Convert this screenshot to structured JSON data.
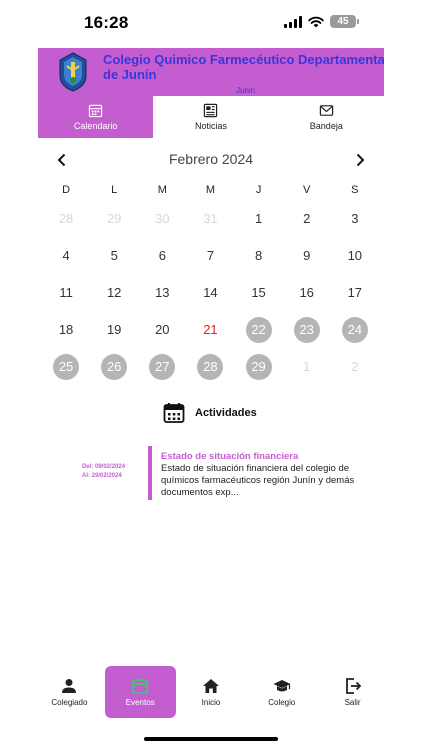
{
  "status": {
    "time": "16:28",
    "battery": "45"
  },
  "header": {
    "title_line1": "Colegio Quimico Farmecéutico Departamental",
    "title_line2": "de Junín",
    "subtitle": "Junin"
  },
  "tabs": [
    {
      "label": "Calendario",
      "icon": "calendar-icon",
      "active": true
    },
    {
      "label": "Noticias",
      "icon": "newspaper-icon",
      "active": false
    },
    {
      "label": "Bandeja",
      "icon": "mail-icon",
      "active": false
    }
  ],
  "calendar": {
    "month": "Febrero 2024",
    "weekdays": [
      "D",
      "L",
      "M",
      "M",
      "J",
      "V",
      "S"
    ],
    "weeks": [
      [
        {
          "d": "28",
          "s": "muted"
        },
        {
          "d": "29",
          "s": "muted"
        },
        {
          "d": "30",
          "s": "muted"
        },
        {
          "d": "31",
          "s": "muted"
        },
        {
          "d": "1",
          "s": ""
        },
        {
          "d": "2",
          "s": ""
        },
        {
          "d": "3",
          "s": ""
        }
      ],
      [
        {
          "d": "4",
          "s": ""
        },
        {
          "d": "5",
          "s": ""
        },
        {
          "d": "6",
          "s": ""
        },
        {
          "d": "7",
          "s": ""
        },
        {
          "d": "8",
          "s": ""
        },
        {
          "d": "9",
          "s": ""
        },
        {
          "d": "10",
          "s": ""
        }
      ],
      [
        {
          "d": "11",
          "s": ""
        },
        {
          "d": "12",
          "s": ""
        },
        {
          "d": "13",
          "s": ""
        },
        {
          "d": "14",
          "s": ""
        },
        {
          "d": "15",
          "s": ""
        },
        {
          "d": "16",
          "s": ""
        },
        {
          "d": "17",
          "s": ""
        }
      ],
      [
        {
          "d": "18",
          "s": ""
        },
        {
          "d": "19",
          "s": ""
        },
        {
          "d": "20",
          "s": ""
        },
        {
          "d": "21",
          "s": "today"
        },
        {
          "d": "22",
          "s": "marked"
        },
        {
          "d": "23",
          "s": "marked"
        },
        {
          "d": "24",
          "s": "marked"
        }
      ],
      [
        {
          "d": "25",
          "s": "marked"
        },
        {
          "d": "26",
          "s": "marked"
        },
        {
          "d": "27",
          "s": "marked"
        },
        {
          "d": "28",
          "s": "marked"
        },
        {
          "d": "29",
          "s": "marked"
        },
        {
          "d": "1",
          "s": "muted"
        },
        {
          "d": "2",
          "s": "muted"
        }
      ]
    ]
  },
  "activities": {
    "title": "Actividades",
    "events": [
      {
        "from": "Del: 09/02/2024",
        "to": "Al: 29/02/2024",
        "title": "Estado de situación financiera",
        "description": "Estado de situación financiera del colegio de químicos farmacéuticos región Junín y demás documentos exp..."
      }
    ]
  },
  "bottom_nav": [
    {
      "label": "Colegiado",
      "icon": "person-icon",
      "active": false
    },
    {
      "label": "Eventos",
      "icon": "calendar-icon",
      "active": true
    },
    {
      "label": "Inicio",
      "icon": "home-icon",
      "active": false
    },
    {
      "label": "Colegio",
      "icon": "graduation-cap-icon",
      "active": false
    },
    {
      "label": "Salir",
      "icon": "logout-icon",
      "active": false
    }
  ],
  "colors": {
    "accent": "#c45ed0",
    "header_text": "#3b36d6",
    "today": "#e02020",
    "marked": "#b5b5b5"
  }
}
